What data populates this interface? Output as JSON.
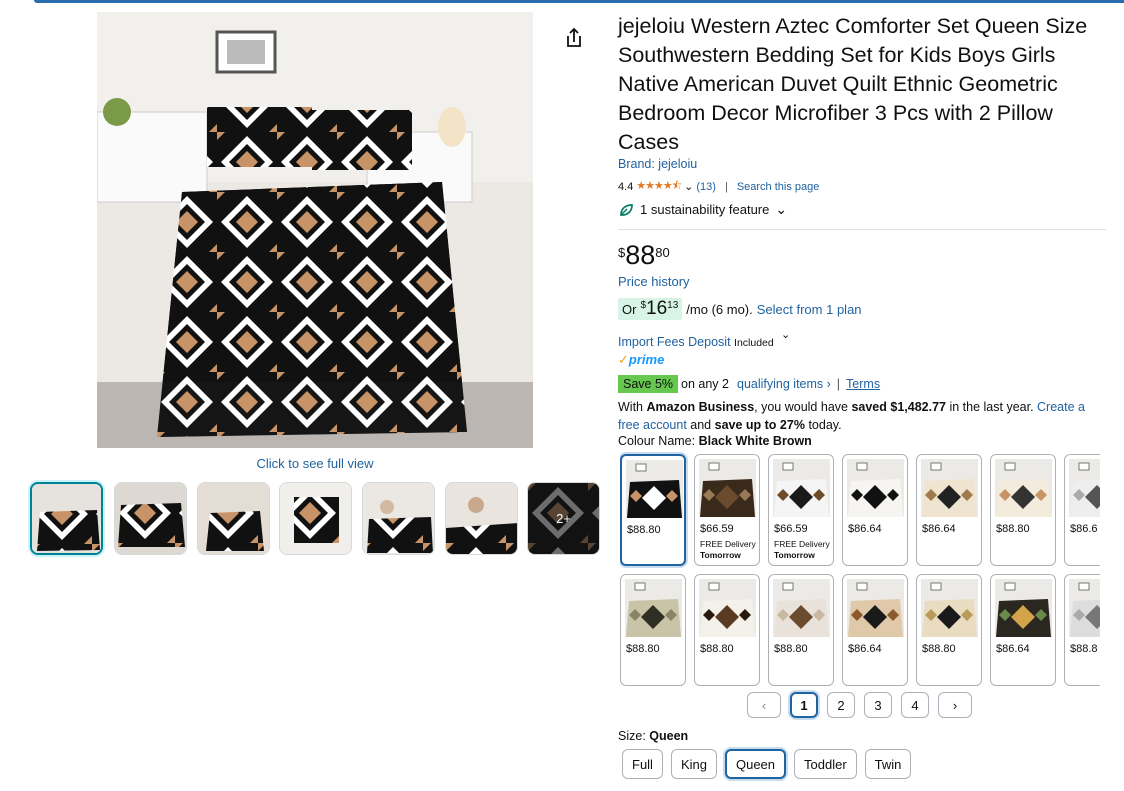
{
  "title": "jejeloiu Western Aztec Comforter Set Queen Size Southwestern Bedding Set for Kids Boys Girls Native American Duvet Quilt Ethnic Geometric Bedroom Decor Microfiber 3 Pcs with 2 Pillow Cases",
  "brand": "Brand: jejeloiu",
  "rating": {
    "value": "4.4",
    "count": "(13)",
    "search": "Search this page"
  },
  "sustainability": "1 sustainability feature",
  "price": {
    "symbol": "$",
    "whole": "88",
    "fraction": "80",
    "history": "Price history"
  },
  "monthly": {
    "or": "Or",
    "symbol": "$",
    "whole": "16",
    "fraction": "13",
    "terms": "/mo (6 mo).",
    "plan_link": "Select from 1 plan"
  },
  "import_fees": {
    "link": "Import Fees Deposit",
    "included": "Included"
  },
  "prime": "prime",
  "save": {
    "badge": "Save 5%",
    "text": "on any 2",
    "qualifying": "qualifying items",
    "terms": "Terms"
  },
  "business": {
    "prefix": "With",
    "name": "Amazon Business",
    "mid": ", you would have",
    "saved": "saved $1,482.77",
    "tail": "in the last year.",
    "create": "Create a free account",
    "and": "and",
    "save_up": "save up to 27%",
    "today": "today."
  },
  "colour": {
    "label": "Colour Name:",
    "value": "Black White Brown"
  },
  "click_full": "Click to see full view",
  "thumb_more": "2+",
  "swatches_row1": [
    {
      "price": "$88.80"
    },
    {
      "price": "$66.59",
      "delivery": "FREE Delivery",
      "when": "Tomorrow"
    },
    {
      "price": "$66.59",
      "delivery": "FREE Delivery",
      "when": "Tomorrow"
    },
    {
      "price": "$86.64"
    },
    {
      "price": "$86.64"
    },
    {
      "price": "$88.80"
    },
    {
      "price": "$86.6"
    }
  ],
  "swatches_row2": [
    {
      "price": "$88.80"
    },
    {
      "price": "$88.80"
    },
    {
      "price": "$88.80"
    },
    {
      "price": "$86.64"
    },
    {
      "price": "$88.80"
    },
    {
      "price": "$86.64"
    },
    {
      "price": "$88.8"
    }
  ],
  "pager": {
    "prev": "‹",
    "pages": [
      "1",
      "2",
      "3",
      "4"
    ],
    "next": "›"
  },
  "size": {
    "label": "Size:",
    "value": "Queen",
    "options": [
      "Full",
      "King",
      "Queen",
      "Toddler",
      "Twin"
    ]
  },
  "colors": {
    "link": "#2162a1",
    "accent": "#008296",
    "save_green": "#66c84e",
    "star": "#de7921"
  }
}
